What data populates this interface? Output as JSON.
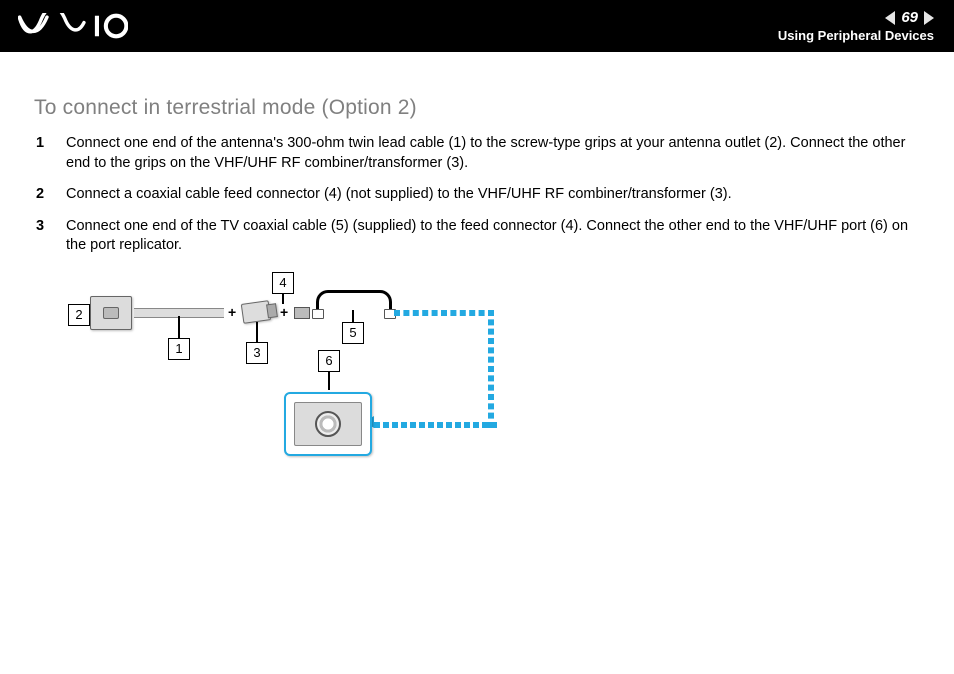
{
  "header": {
    "page_number": "69",
    "section": "Using Peripheral Devices",
    "brand": "VAIO"
  },
  "body": {
    "heading": "To connect in terrestrial mode (Option 2)",
    "steps": [
      "Connect one end of the antenna's 300-ohm twin lead cable (1) to the screw-type grips at your antenna outlet (2). Connect the other end to the grips on the VHF/UHF RF combiner/transformer (3).",
      "Connect a coaxial cable feed connector (4) (not supplied) to the VHF/UHF RF combiner/transformer (3).",
      "Connect one end of the TV coaxial cable (5) (supplied) to the feed connector (4). Connect the other end to the VHF/UHF port (6) on the port replicator."
    ]
  },
  "diagram": {
    "callouts": {
      "1": "1",
      "2": "2",
      "3": "3",
      "4": "4",
      "5": "5",
      "6": "6"
    },
    "accent_color": "#23a9e1"
  }
}
